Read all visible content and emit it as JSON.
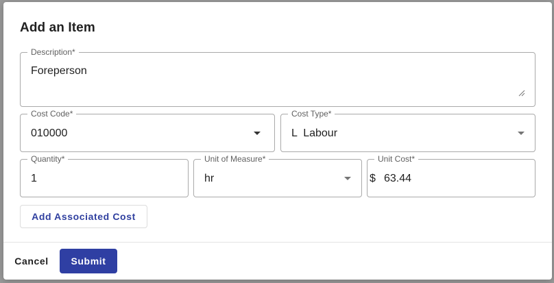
{
  "dialog": {
    "title": "Add an Item",
    "fields": {
      "description": {
        "label": "Description*",
        "value": "Foreperson"
      },
      "cost_code": {
        "label": "Cost Code*",
        "value": "010000"
      },
      "cost_type": {
        "label": "Cost Type*",
        "value": "L  Labour"
      },
      "quantity": {
        "label": "Quantity*",
        "value": "1"
      },
      "unit_of_measure": {
        "label": "Unit of Measure*",
        "value": "hr"
      },
      "unit_cost": {
        "label": "Unit Cost*",
        "prefix": "$",
        "value": "63.44"
      }
    },
    "add_associated_cost_label": "Add Associated Cost",
    "footer": {
      "cancel_label": "Cancel",
      "submit_label": "Submit"
    }
  },
  "icons": {
    "cost_code_caret": "chevron-down-icon",
    "cost_type_caret": "chevron-down-icon",
    "unit_caret": "chevron-down-icon",
    "textarea_resize": "resize-handle-icon"
  },
  "colors": {
    "primary": "#2f3fa3",
    "overlay": "#9a9a9a",
    "border": "#a9a9a9"
  }
}
